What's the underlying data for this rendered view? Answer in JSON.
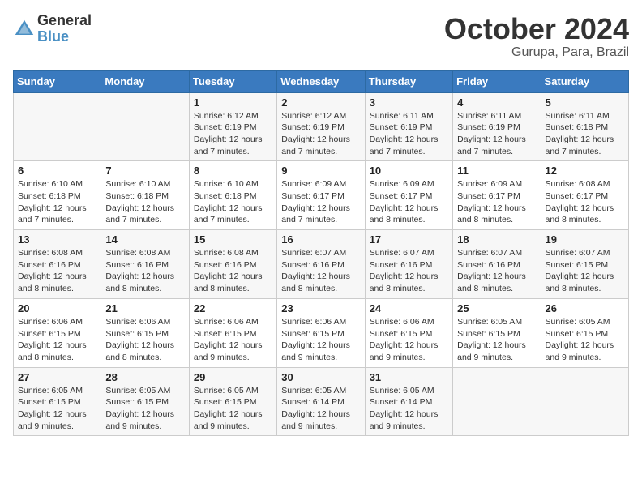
{
  "header": {
    "logo_general": "General",
    "logo_blue": "Blue",
    "month_title": "October 2024",
    "location": "Gurupa, Para, Brazil"
  },
  "weekdays": [
    "Sunday",
    "Monday",
    "Tuesday",
    "Wednesday",
    "Thursday",
    "Friday",
    "Saturday"
  ],
  "weeks": [
    [
      {
        "day": "",
        "detail": ""
      },
      {
        "day": "",
        "detail": ""
      },
      {
        "day": "1",
        "detail": "Sunrise: 6:12 AM\nSunset: 6:19 PM\nDaylight: 12 hours\nand 7 minutes."
      },
      {
        "day": "2",
        "detail": "Sunrise: 6:12 AM\nSunset: 6:19 PM\nDaylight: 12 hours\nand 7 minutes."
      },
      {
        "day": "3",
        "detail": "Sunrise: 6:11 AM\nSunset: 6:19 PM\nDaylight: 12 hours\nand 7 minutes."
      },
      {
        "day": "4",
        "detail": "Sunrise: 6:11 AM\nSunset: 6:19 PM\nDaylight: 12 hours\nand 7 minutes."
      },
      {
        "day": "5",
        "detail": "Sunrise: 6:11 AM\nSunset: 6:18 PM\nDaylight: 12 hours\nand 7 minutes."
      }
    ],
    [
      {
        "day": "6",
        "detail": "Sunrise: 6:10 AM\nSunset: 6:18 PM\nDaylight: 12 hours\nand 7 minutes."
      },
      {
        "day": "7",
        "detail": "Sunrise: 6:10 AM\nSunset: 6:18 PM\nDaylight: 12 hours\nand 7 minutes."
      },
      {
        "day": "8",
        "detail": "Sunrise: 6:10 AM\nSunset: 6:18 PM\nDaylight: 12 hours\nand 7 minutes."
      },
      {
        "day": "9",
        "detail": "Sunrise: 6:09 AM\nSunset: 6:17 PM\nDaylight: 12 hours\nand 7 minutes."
      },
      {
        "day": "10",
        "detail": "Sunrise: 6:09 AM\nSunset: 6:17 PM\nDaylight: 12 hours\nand 8 minutes."
      },
      {
        "day": "11",
        "detail": "Sunrise: 6:09 AM\nSunset: 6:17 PM\nDaylight: 12 hours\nand 8 minutes."
      },
      {
        "day": "12",
        "detail": "Sunrise: 6:08 AM\nSunset: 6:17 PM\nDaylight: 12 hours\nand 8 minutes."
      }
    ],
    [
      {
        "day": "13",
        "detail": "Sunrise: 6:08 AM\nSunset: 6:16 PM\nDaylight: 12 hours\nand 8 minutes."
      },
      {
        "day": "14",
        "detail": "Sunrise: 6:08 AM\nSunset: 6:16 PM\nDaylight: 12 hours\nand 8 minutes."
      },
      {
        "day": "15",
        "detail": "Sunrise: 6:08 AM\nSunset: 6:16 PM\nDaylight: 12 hours\nand 8 minutes."
      },
      {
        "day": "16",
        "detail": "Sunrise: 6:07 AM\nSunset: 6:16 PM\nDaylight: 12 hours\nand 8 minutes."
      },
      {
        "day": "17",
        "detail": "Sunrise: 6:07 AM\nSunset: 6:16 PM\nDaylight: 12 hours\nand 8 minutes."
      },
      {
        "day": "18",
        "detail": "Sunrise: 6:07 AM\nSunset: 6:16 PM\nDaylight: 12 hours\nand 8 minutes."
      },
      {
        "day": "19",
        "detail": "Sunrise: 6:07 AM\nSunset: 6:15 PM\nDaylight: 12 hours\nand 8 minutes."
      }
    ],
    [
      {
        "day": "20",
        "detail": "Sunrise: 6:06 AM\nSunset: 6:15 PM\nDaylight: 12 hours\nand 8 minutes."
      },
      {
        "day": "21",
        "detail": "Sunrise: 6:06 AM\nSunset: 6:15 PM\nDaylight: 12 hours\nand 8 minutes."
      },
      {
        "day": "22",
        "detail": "Sunrise: 6:06 AM\nSunset: 6:15 PM\nDaylight: 12 hours\nand 9 minutes."
      },
      {
        "day": "23",
        "detail": "Sunrise: 6:06 AM\nSunset: 6:15 PM\nDaylight: 12 hours\nand 9 minutes."
      },
      {
        "day": "24",
        "detail": "Sunrise: 6:06 AM\nSunset: 6:15 PM\nDaylight: 12 hours\nand 9 minutes."
      },
      {
        "day": "25",
        "detail": "Sunrise: 6:05 AM\nSunset: 6:15 PM\nDaylight: 12 hours\nand 9 minutes."
      },
      {
        "day": "26",
        "detail": "Sunrise: 6:05 AM\nSunset: 6:15 PM\nDaylight: 12 hours\nand 9 minutes."
      }
    ],
    [
      {
        "day": "27",
        "detail": "Sunrise: 6:05 AM\nSunset: 6:15 PM\nDaylight: 12 hours\nand 9 minutes."
      },
      {
        "day": "28",
        "detail": "Sunrise: 6:05 AM\nSunset: 6:15 PM\nDaylight: 12 hours\nand 9 minutes."
      },
      {
        "day": "29",
        "detail": "Sunrise: 6:05 AM\nSunset: 6:15 PM\nDaylight: 12 hours\nand 9 minutes."
      },
      {
        "day": "30",
        "detail": "Sunrise: 6:05 AM\nSunset: 6:14 PM\nDaylight: 12 hours\nand 9 minutes."
      },
      {
        "day": "31",
        "detail": "Sunrise: 6:05 AM\nSunset: 6:14 PM\nDaylight: 12 hours\nand 9 minutes."
      },
      {
        "day": "",
        "detail": ""
      },
      {
        "day": "",
        "detail": ""
      }
    ]
  ]
}
